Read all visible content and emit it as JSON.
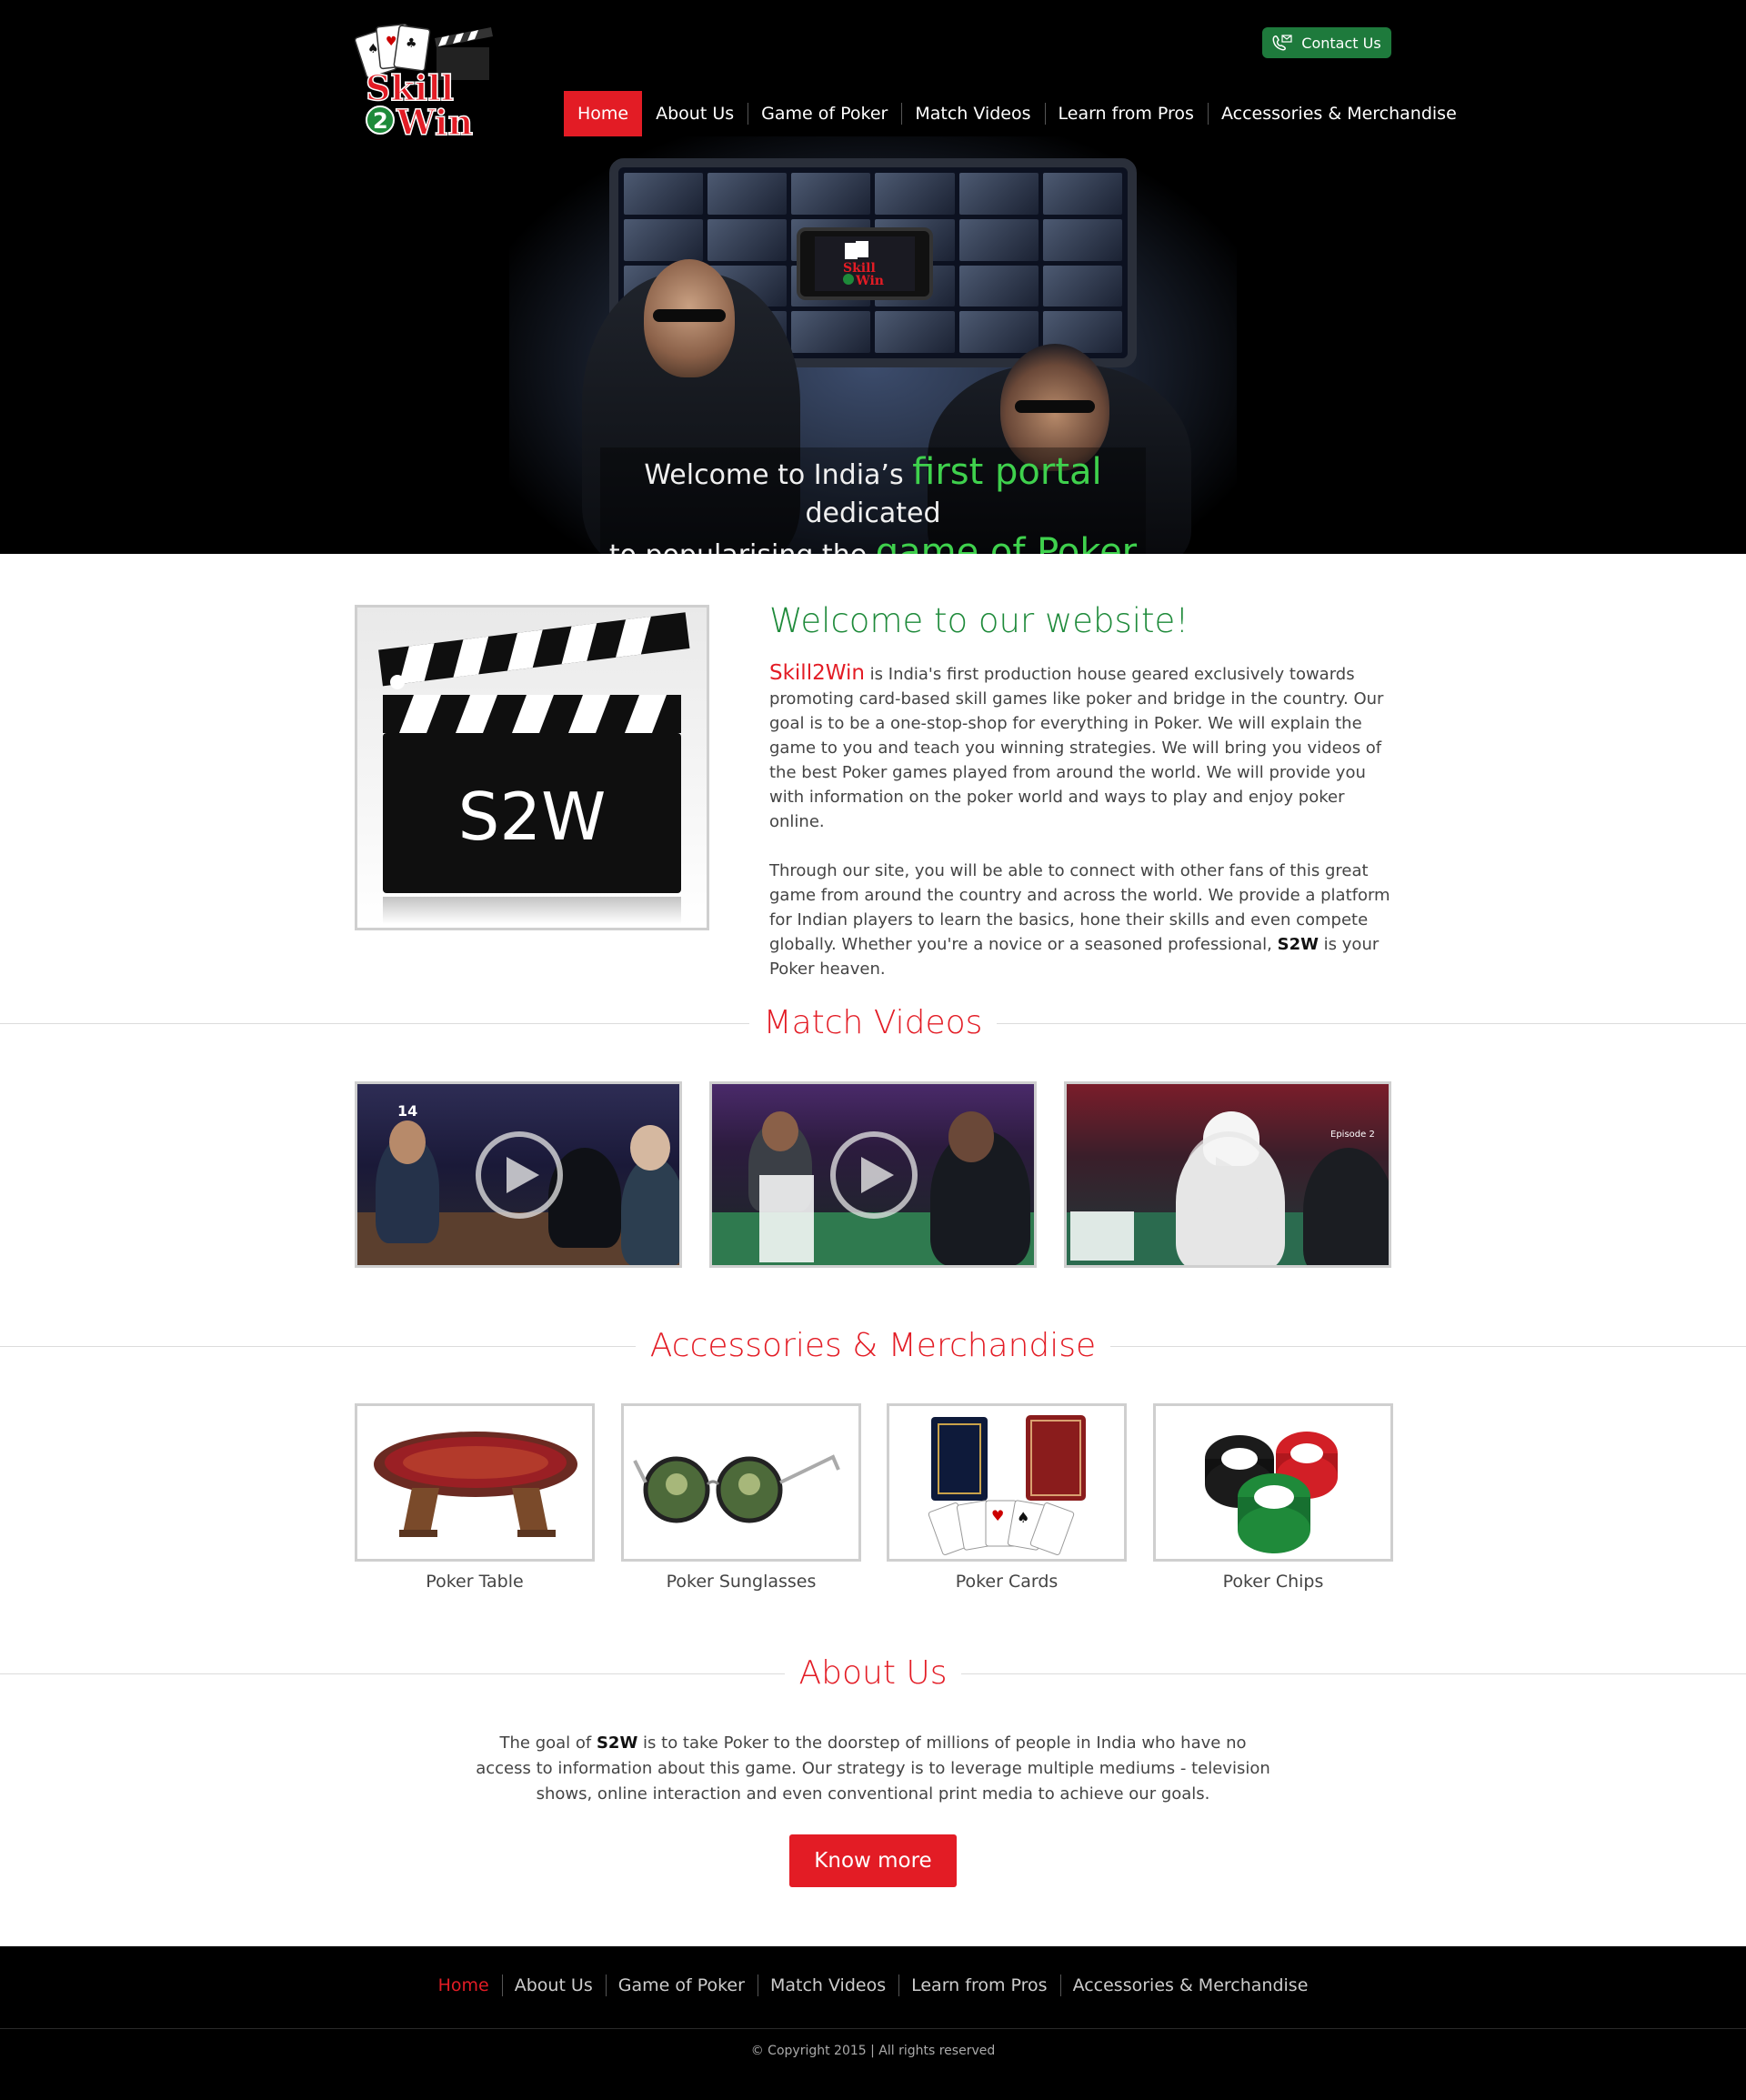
{
  "header": {
    "logo_text_top": "Skill",
    "logo_text_mid": "2",
    "logo_text_bottom": "Win",
    "contact_label": "Contact Us",
    "nav": [
      {
        "label": "Home",
        "active": true
      },
      {
        "label": "About Us",
        "active": false
      },
      {
        "label": "Game of Poker",
        "active": false
      },
      {
        "label": "Match Videos",
        "active": false
      },
      {
        "label": "Learn from Pros",
        "active": false
      },
      {
        "label": "Accessories & Merchandise",
        "active": false
      }
    ]
  },
  "hero": {
    "line1_before": "Welcome to India’s ",
    "line1_highlight": "first portal",
    "line1_after": " dedicated",
    "line2_before": "to popularising the ",
    "line2_highlight": "game of Poker"
  },
  "welcome": {
    "clapper_text": "S2W",
    "title": "Welcome to our website!",
    "brand": "Skill2Win",
    "para1_rest": " is India's first production house geared exclusively towards promoting card-based skill games like poker and bridge in the country. Our goal is to be a one-stop-shop for everything in Poker. We will explain the game to you and teach you winning strategies. We will bring you videos of the best Poker games played from around the world. We will provide you with information on the poker world and ways to play and enjoy poker online.",
    "para2_before": "Through our site, you will be able to connect with other fans of this great game from around the country and across the world. We provide a platform for Indian players to learn the basics, hone their skills and even compete globally. Whether you're a novice or a seasoned professional, ",
    "para2_bold": "S2W",
    "para2_after": " is your Poker heaven."
  },
  "videos": {
    "title": "Match Videos",
    "items": [
      {
        "badge": "14"
      },
      {
        "badge": ""
      },
      {
        "badge": "Episode 2"
      }
    ]
  },
  "accessories": {
    "title": "Accessories & Merchandise",
    "items": [
      {
        "label": "Poker Table"
      },
      {
        "label": "Poker Sunglasses"
      },
      {
        "label": "Poker Cards"
      },
      {
        "label": "Poker Chips"
      }
    ]
  },
  "about": {
    "title": "About Us",
    "text_before": "The goal of ",
    "text_bold": "S2W",
    "text_after": " is to take Poker to the doorstep of millions of people in India who have no access to information about this game. Our strategy is to leverage multiple mediums - television shows, online interaction and even conventional print media to achieve our goals.",
    "button_label": "Know more"
  },
  "footer": {
    "nav": [
      {
        "label": "Home",
        "active": true
      },
      {
        "label": "About Us",
        "active": false
      },
      {
        "label": "Game of Poker",
        "active": false
      },
      {
        "label": "Match Videos",
        "active": false
      },
      {
        "label": "Learn from Pros",
        "active": false
      },
      {
        "label": "Accessories & Merchandise",
        "active": false
      }
    ],
    "copyright": "© Copyright 2015 | All rights reserved"
  },
  "colors": {
    "brand_red": "#e31c25",
    "brand_green": "#1e8a3a",
    "hero_highlight": "#3fd14d"
  }
}
